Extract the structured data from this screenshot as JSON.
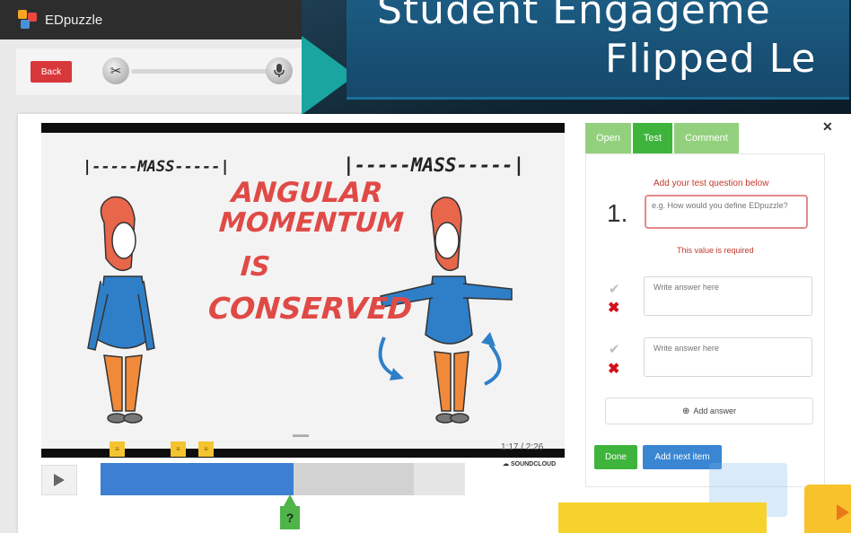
{
  "app": {
    "title": "EDpuzzle",
    "back_label": "Back"
  },
  "banner": {
    "line1": "Student Engageme",
    "line2": "Flipped Le"
  },
  "video": {
    "mass_left": "|-----MASS-----|",
    "mass_right": "|-----MASS-----|",
    "headline": [
      "ANGULAR",
      "MOMENTUM",
      "IS",
      "CONSERVED"
    ],
    "time": "1:17 / 2:26",
    "source": "SOUNDCLOUD",
    "progress_fraction": 0.53,
    "buffer_fraction": 0.86,
    "question_marker": "?"
  },
  "panel": {
    "tabs": [
      {
        "label": "Open",
        "active": false
      },
      {
        "label": "Test",
        "active": true
      },
      {
        "label": "Comment",
        "active": false
      }
    ],
    "hint": "Add your test question below",
    "question_number": "1.",
    "question_placeholder": "e.g. How would you define EDpuzzle?",
    "error": "This value is required",
    "answers": [
      {
        "placeholder": "Write answer here"
      },
      {
        "placeholder": "Write answer here"
      }
    ],
    "add_answer": "Add answer",
    "done": "Done",
    "add_next": "Add next item"
  },
  "colors": {
    "accent_green": "#3fb43c",
    "accent_blue": "#3a86d3",
    "headline_red": "#e04a46",
    "marker_yellow": "#f4c430"
  }
}
